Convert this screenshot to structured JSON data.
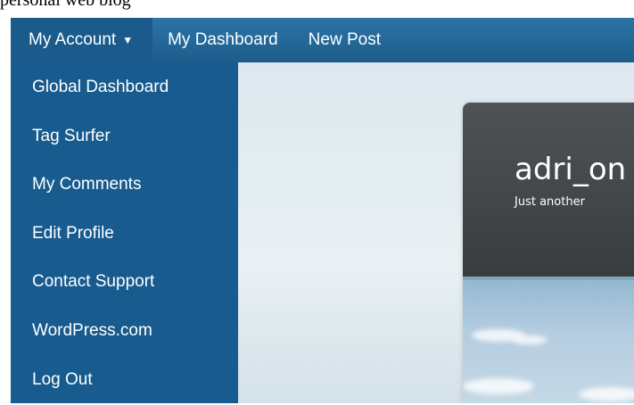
{
  "page": {
    "title": "personal web blog"
  },
  "admin_bar": {
    "account_label": "My Account",
    "dashboard_label": "My Dashboard",
    "new_post_label": "New Post"
  },
  "account_menu": {
    "items": [
      {
        "label": "Global Dashboard"
      },
      {
        "label": "Tag Surfer"
      },
      {
        "label": "My Comments"
      },
      {
        "label": "Edit Profile"
      },
      {
        "label": "Contact Support"
      },
      {
        "label": "WordPress.com"
      },
      {
        "label": "Log Out"
      }
    ]
  },
  "blog": {
    "title": "adri_on",
    "tagline": "Just another"
  },
  "colors": {
    "admin_bar": "#1f6496",
    "menu_background": "#185b8e",
    "header_dark": "#43484b"
  }
}
